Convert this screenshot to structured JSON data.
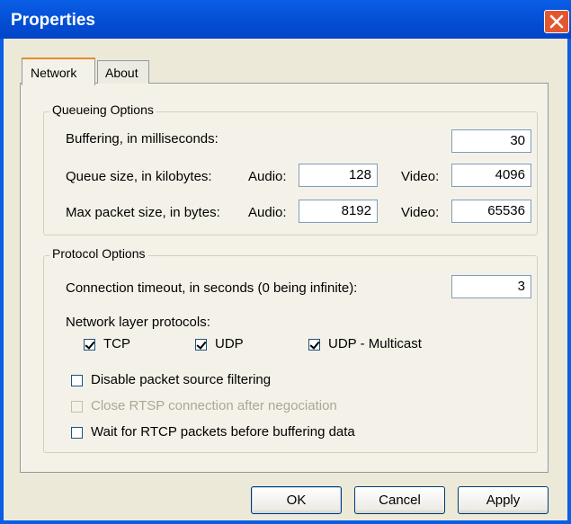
{
  "window": {
    "title": "Properties"
  },
  "tabs": [
    {
      "label": "Network",
      "active": true
    },
    {
      "label": "About",
      "active": false
    }
  ],
  "queueing": {
    "title": "Queueing Options",
    "buffering_label": "Buffering, in milliseconds:",
    "buffering_value": "30",
    "queue_label": "Queue size, in kilobytes:",
    "max_packet_label": "Max packet size, in bytes:",
    "audio_label": "Audio:",
    "video_label": "Video:",
    "queue_audio": "128",
    "queue_video": "4096",
    "packet_audio": "8192",
    "packet_video": "65536"
  },
  "protocol": {
    "title": "Protocol Options",
    "timeout_label": "Connection timeout, in seconds (0 being infinite):",
    "timeout_value": "3",
    "network_label": "Network layer protocols:",
    "tcp": {
      "label": "TCP",
      "checked": true
    },
    "udp": {
      "label": "UDP",
      "checked": true
    },
    "multicast": {
      "label": "UDP - Multicast",
      "checked": true
    },
    "disable_filtering": {
      "label": "Disable packet source filtering",
      "checked": false
    },
    "close_rtsp": {
      "label": "Close RTSP connection after negociation",
      "checked": false,
      "disabled": true
    },
    "wait_rtcp": {
      "label": "Wait for RTCP packets before buffering data",
      "checked": false
    }
  },
  "buttons": {
    "ok": "OK",
    "cancel": "Cancel",
    "apply": "Apply"
  }
}
